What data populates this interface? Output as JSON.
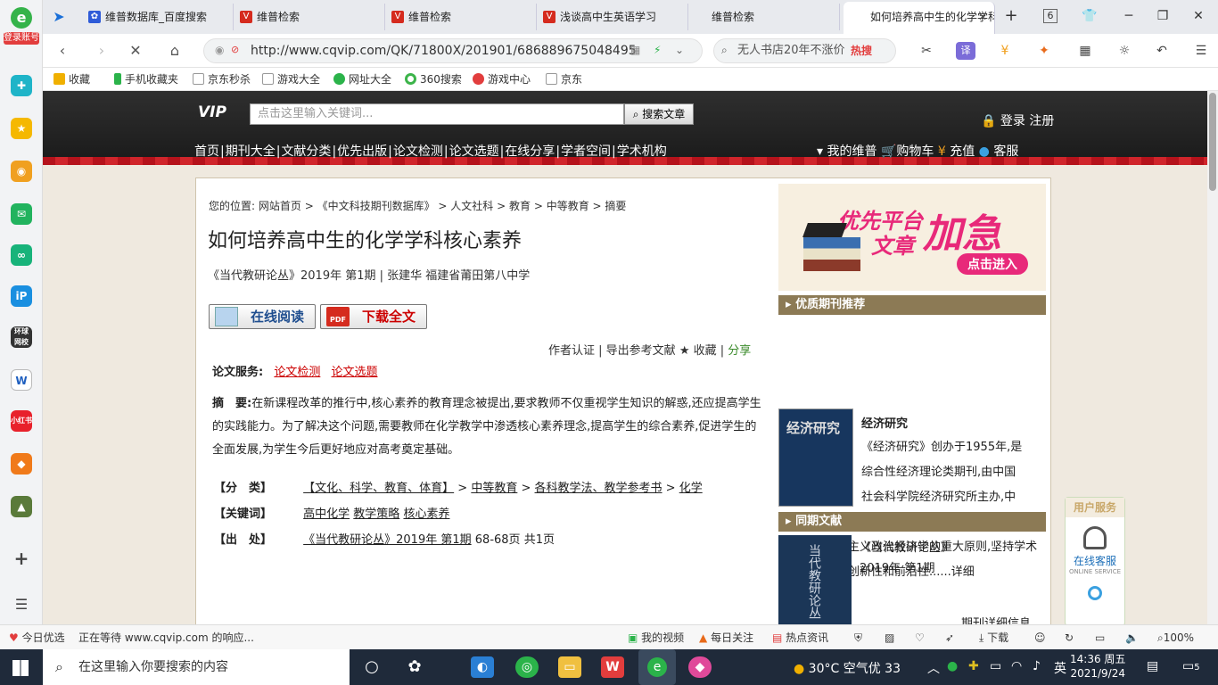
{
  "sidebar": {
    "login_label": "登录账号",
    "logo_char": "e"
  },
  "tabs": [
    {
      "label": "维普数据库_百度搜索"
    },
    {
      "label": "维普检索"
    },
    {
      "label": "维普检索"
    },
    {
      "label": "浅谈高中生英语学习"
    },
    {
      "label": "维普检索"
    },
    {
      "label": "如何培养高中生的化学学科核心素养"
    }
  ],
  "tab_count": "6",
  "address": {
    "url": "http://www.cqvip.com/QK/71800X/201901/686889675048495",
    "search_text": "无人书店20年不涨价",
    "hot_label": "热搜"
  },
  "bookmarks": [
    {
      "label": "收藏"
    },
    {
      "label": "手机收藏夹"
    },
    {
      "label": "京东秒杀"
    },
    {
      "label": "游戏大全"
    },
    {
      "label": "网址大全"
    },
    {
      "label": "360搜索"
    },
    {
      "label": "游戏中心"
    },
    {
      "label": "京东"
    }
  ],
  "site": {
    "logo": "VIP",
    "search_placeholder": "点击这里输入关键词...",
    "search_button": "搜索文章",
    "login": "登录",
    "register": "注册",
    "nav": [
      "首页",
      "期刊大全",
      "文献分类",
      "优先出版",
      "论文检测",
      "论文选题",
      "在线分享",
      "学者空间",
      "学术机构"
    ],
    "topright": [
      "我的维普",
      "购物车",
      "充值",
      "客服"
    ]
  },
  "article": {
    "breadcrumb": [
      "您的位置:",
      "网站首页",
      "《中文科技期刊数据库》",
      "人文社科",
      "教育",
      "中等教育",
      "摘要"
    ],
    "title": "如何培养高中生的化学学科核心素养",
    "meta": "《当代教研论丛》2019年 第1期 | 张建华 福建省莆田第八中学",
    "read_button": "在线阅读",
    "download_button": "下载全文",
    "actions": [
      "作者认证",
      "导出参考文献",
      "★ 收藏",
      "分享"
    ],
    "service_label": "论文服务:",
    "service_links": [
      "论文检测",
      "论文选题"
    ],
    "abstract_label": "摘　要:",
    "abstract": "在新课程改革的推行中,核心素养的教育理念被提出,要求教师不仅重视学生知识的解惑,还应提高学生的实践能力。为了解决这个问题,需要教师在化学教学中渗透核心素养理念,提高学生的综合素养,促进学生的全面发展,为学生今后更好地应对高考奠定基础。",
    "class_label": "【分　类】",
    "class_items": [
      "【文化、科学、教育、体育】",
      "中等教育",
      "各科教学法、教学参考书",
      "化学"
    ],
    "keyword_label": "【关键词】",
    "keywords": [
      "高中化学",
      "教学策略",
      "核心素养"
    ],
    "source_label": "【出　处】",
    "source_link": "《当代教研论丛》2019年 第1期",
    "source_pages": "68-68页 共1页"
  },
  "right": {
    "banner": {
      "line1": "优先平台",
      "line2": "文章",
      "big": "加急",
      "button": "点击进入"
    },
    "journal_header": "优质期刊推荐",
    "journal_cover_title": "经济研究",
    "journal_name": "经济研究",
    "journal_desc_1": "《经济研究》创办于1955年,是",
    "journal_desc_2": "综合性经济理论类期刊,由中国",
    "journal_desc_3": "社会科学院经济研究所主办,中",
    "journal_desc_4": "国社会科学院主管。本刊以马克思主义为指导,坚持中国特色社会主义政治经济学的重大原则,坚持学术性、时代性、创新性和前沿性......",
    "journal_more": "详细",
    "same_header": "同期文献",
    "same_cover_title": "当代教研论丛",
    "same_name": "《当代教研论丛》",
    "same_issue": "2019年 第1期",
    "same_more": "期刊详细信息"
  },
  "user_service": {
    "header": "用户服务",
    "link": "在线客服",
    "sub": "ONLINE SERVICE"
  },
  "status": {
    "left1": "今日优选",
    "left2": "正在等待 www.cqvip.com 的响应...",
    "items": [
      "我的视频",
      "每日关注",
      "热点资讯",
      "下载"
    ],
    "zoom": "100%"
  },
  "taskbar": {
    "search_placeholder": "在这里输入你要搜索的内容",
    "weather": "30°C 空气优 33",
    "ime": "英",
    "time": "14:36 周五",
    "date": "2021/9/24",
    "notif": "5"
  },
  "colors": {
    "brand_red": "#d0252b",
    "accent_gold": "#8c7a55",
    "link_red": "#cc0000",
    "nav_dark": "#1a1a1a"
  }
}
